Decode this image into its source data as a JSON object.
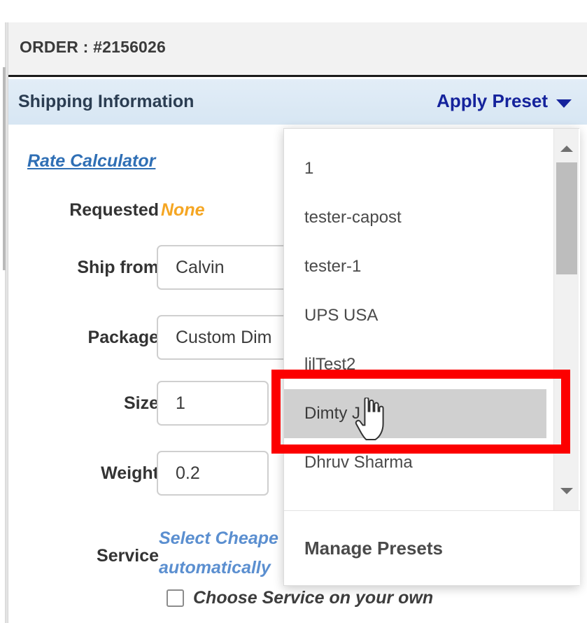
{
  "order": {
    "title": "ORDER : #2156026"
  },
  "section": {
    "title": "Shipping Information",
    "apply_preset_label": "Apply Preset",
    "caret_icon": "chevron-down-icon"
  },
  "form": {
    "rate_calculator_link": "Rate Calculator",
    "rows": [
      {
        "label": "Requested",
        "value": "None",
        "type": "text"
      },
      {
        "label": "Ship from",
        "value": "Calvin",
        "type": "input"
      },
      {
        "label": "Package",
        "value": "Custom Dim",
        "type": "input"
      },
      {
        "label": "Size",
        "value": "1",
        "type": "input-narrow"
      },
      {
        "label": "Weight",
        "value": "0.2",
        "type": "input-narrow"
      }
    ],
    "service": {
      "label": "Service",
      "line1": "Select Cheape",
      "line2": "automatically",
      "checkbox_label": "Choose Service on your own",
      "checkbox_checked": false
    }
  },
  "dropdown": {
    "items": [
      "1",
      "tester-capost",
      "tester-1",
      "UPS USA",
      "lilTest2",
      "Dimty J",
      "Dhruv Sharma"
    ],
    "selected_index": 5,
    "footer_label": "Manage Presets",
    "scroll_up_icon": "scroll-up-arrow-icon",
    "scroll_down_icon": "scroll-down-arrow-icon"
  },
  "annotation": {
    "highlight_color": "#fc0000"
  },
  "cursor": {
    "icon": "pointer-hand-cursor"
  },
  "colors": {
    "header_band": "#dce9f4",
    "accent_blue": "#15239c",
    "link_blue": "#2f6fb5",
    "warning_orange": "#f5a623",
    "selected_row": "#d0d0d0"
  }
}
